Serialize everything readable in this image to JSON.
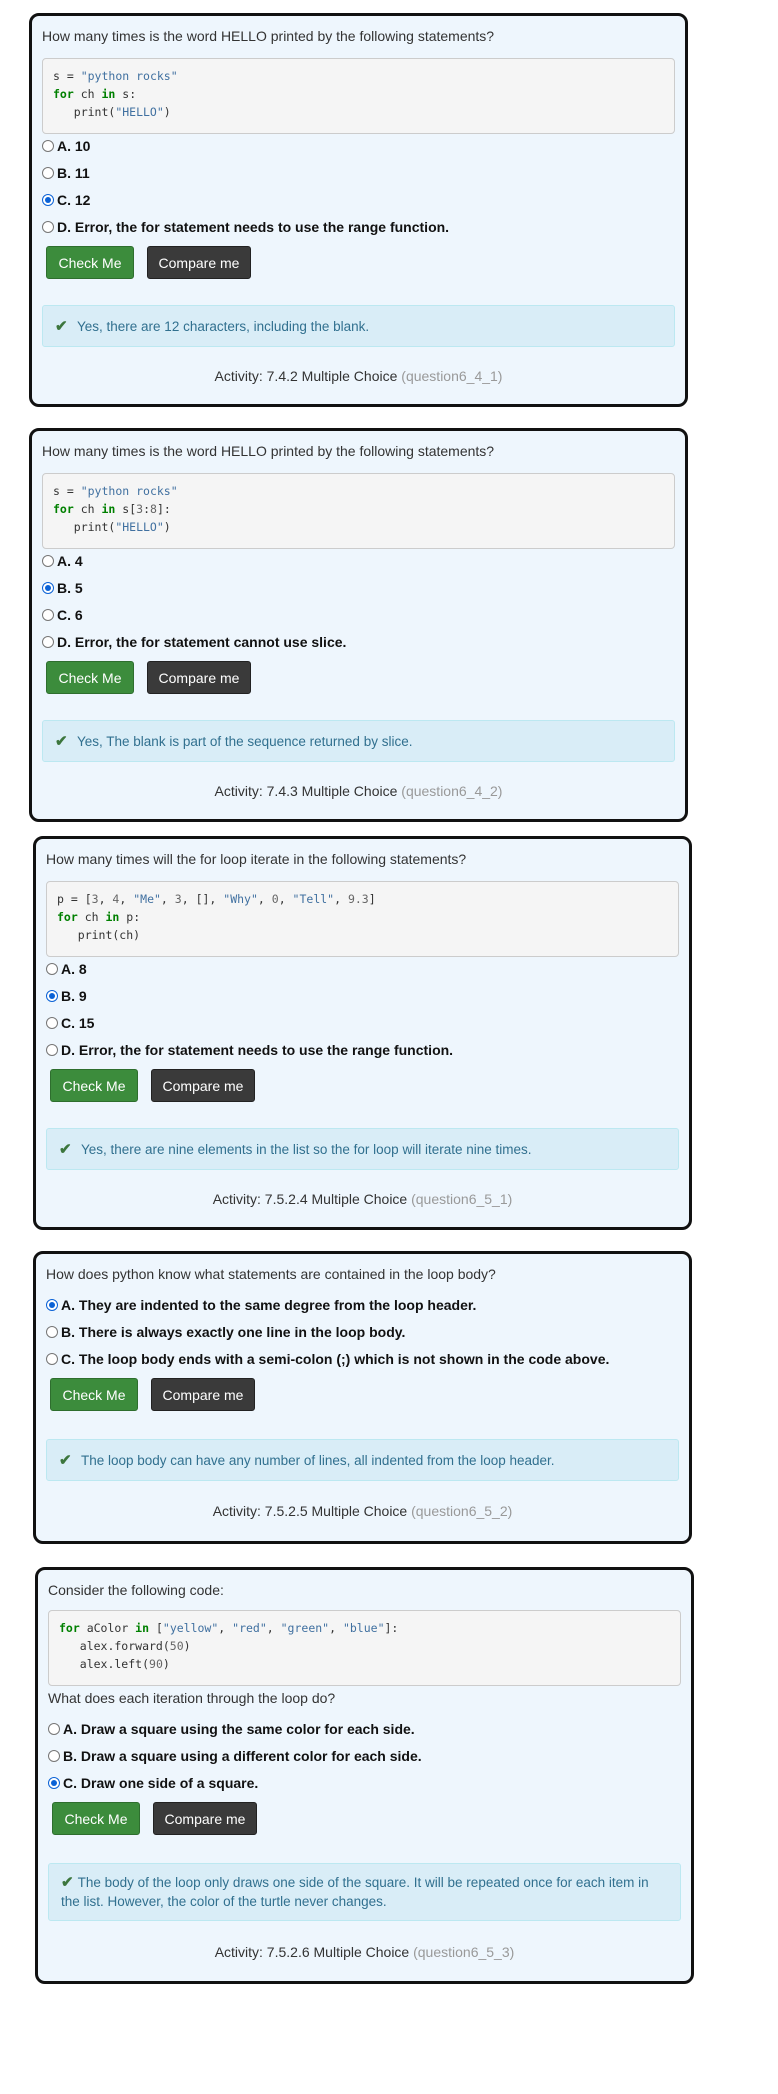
{
  "cards": [
    {
      "question": "How many times is the word HELLO printed by the following statements?",
      "code_lines": [
        [
          "s = ",
          "\"python rocks\""
        ],
        [
          "for ch in s:"
        ],
        [
          "   print(\"HELLO\")"
        ]
      ],
      "options": [
        "A. 10",
        "B. 11",
        "C. 12",
        "D. Error, the for statement needs to use the range function."
      ],
      "selected": 2,
      "check_label": "Check Me",
      "compare_label": "Compare me",
      "feedback": "Yes, there are 12 characters, including the blank.",
      "activity": "Activity: 7.4.2 Multiple Choice",
      "activity_id": "(question6_4_1)"
    },
    {
      "question": "How many times is the word HELLO printed by the following statements?",
      "options": [
        "A. 4",
        "B. 5",
        "C. 6",
        "D. Error, the for statement cannot use slice."
      ],
      "selected": 1,
      "check_label": "Check Me",
      "compare_label": "Compare me",
      "feedback": "Yes, The blank is part of the sequence returned by slice.",
      "activity": "Activity: 7.4.3 Multiple Choice",
      "activity_id": "(question6_4_2)"
    },
    {
      "question": "How many times will the for loop iterate in the following statements?",
      "options": [
        "A. 8",
        "B. 9",
        "C. 15",
        "D. Error, the for statement needs to use the range function."
      ],
      "selected": 1,
      "check_label": "Check Me",
      "compare_label": "Compare me",
      "feedback": "Yes, there are nine elements in the list so the for loop will iterate nine times.",
      "activity": "Activity: 7.5.2.4 Multiple Choice",
      "activity_id": "(question6_5_1)"
    },
    {
      "question": "How does python know what statements are contained in the loop body?",
      "options": [
        "A. They are indented to the same degree from the loop header.",
        "B. There is always exactly one line in the loop body.",
        "C. The loop body ends with a semi-colon (;) which is not shown in the code above."
      ],
      "selected": 0,
      "check_label": "Check Me",
      "compare_label": "Compare me",
      "feedback": "The loop body can have any number of lines, all indented from the loop header.",
      "activity": "Activity: 7.5.2.5 Multiple Choice",
      "activity_id": "(question6_5_2)"
    },
    {
      "question": "Consider the following code:",
      "question2": "What does each iteration through the loop do?",
      "options": [
        "A. Draw a square using the same color for each side.",
        "B. Draw a square using a different color for each side.",
        "C. Draw one side of a square."
      ],
      "selected": 2,
      "check_label": "Check Me",
      "compare_label": "Compare me",
      "feedback": "The body of the loop only draws one side of the square. It will be repeated once for each item in the list. However, the color of the turtle never changes.",
      "activity": "Activity: 7.5.2.6 Multiple Choice",
      "activity_id": "(question6_5_3)"
    }
  ]
}
